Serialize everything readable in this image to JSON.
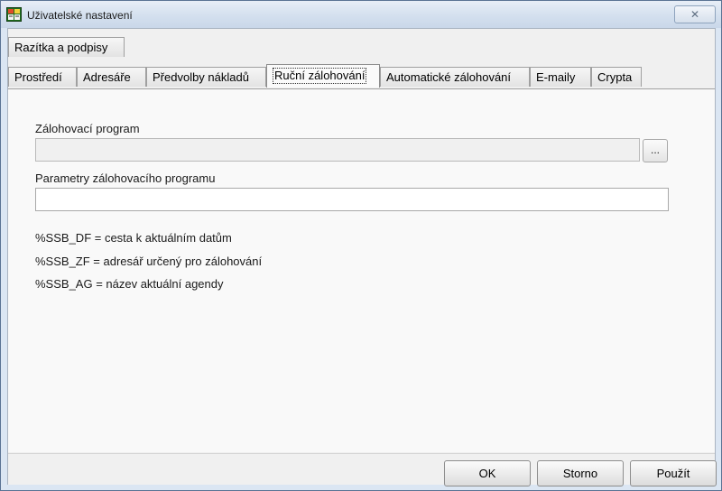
{
  "window": {
    "title": "Uživatelské nastavení",
    "close_glyph": "✕"
  },
  "tabs_row1": [
    {
      "label": "Razítka a podpisy"
    }
  ],
  "tabs_row2": [
    {
      "label": "Prostředí"
    },
    {
      "label": "Adresáře"
    },
    {
      "label": "Předvolby nákladů"
    },
    {
      "label": "Ruční zálohování",
      "active": true
    },
    {
      "label": "Automatické zálohování"
    },
    {
      "label": "E-maily"
    },
    {
      "label": "Crypta"
    }
  ],
  "panel": {
    "backup_program_label": "Zálohovací program",
    "backup_program_value": "",
    "browse_label": "...",
    "params_label": "Parametry zálohovacího programu",
    "params_value": "",
    "help_lines": [
      "%SSB_DF = cesta k aktuálním datům",
      "%SSB_ZF = adresář určený pro zálohování",
      "%SSB_AG = název aktuální agendy"
    ]
  },
  "buttons": {
    "ok": "OK",
    "cancel": "Storno",
    "apply": "Použít"
  },
  "icons": {
    "app": "app-grid-icon",
    "close": "close-icon"
  }
}
